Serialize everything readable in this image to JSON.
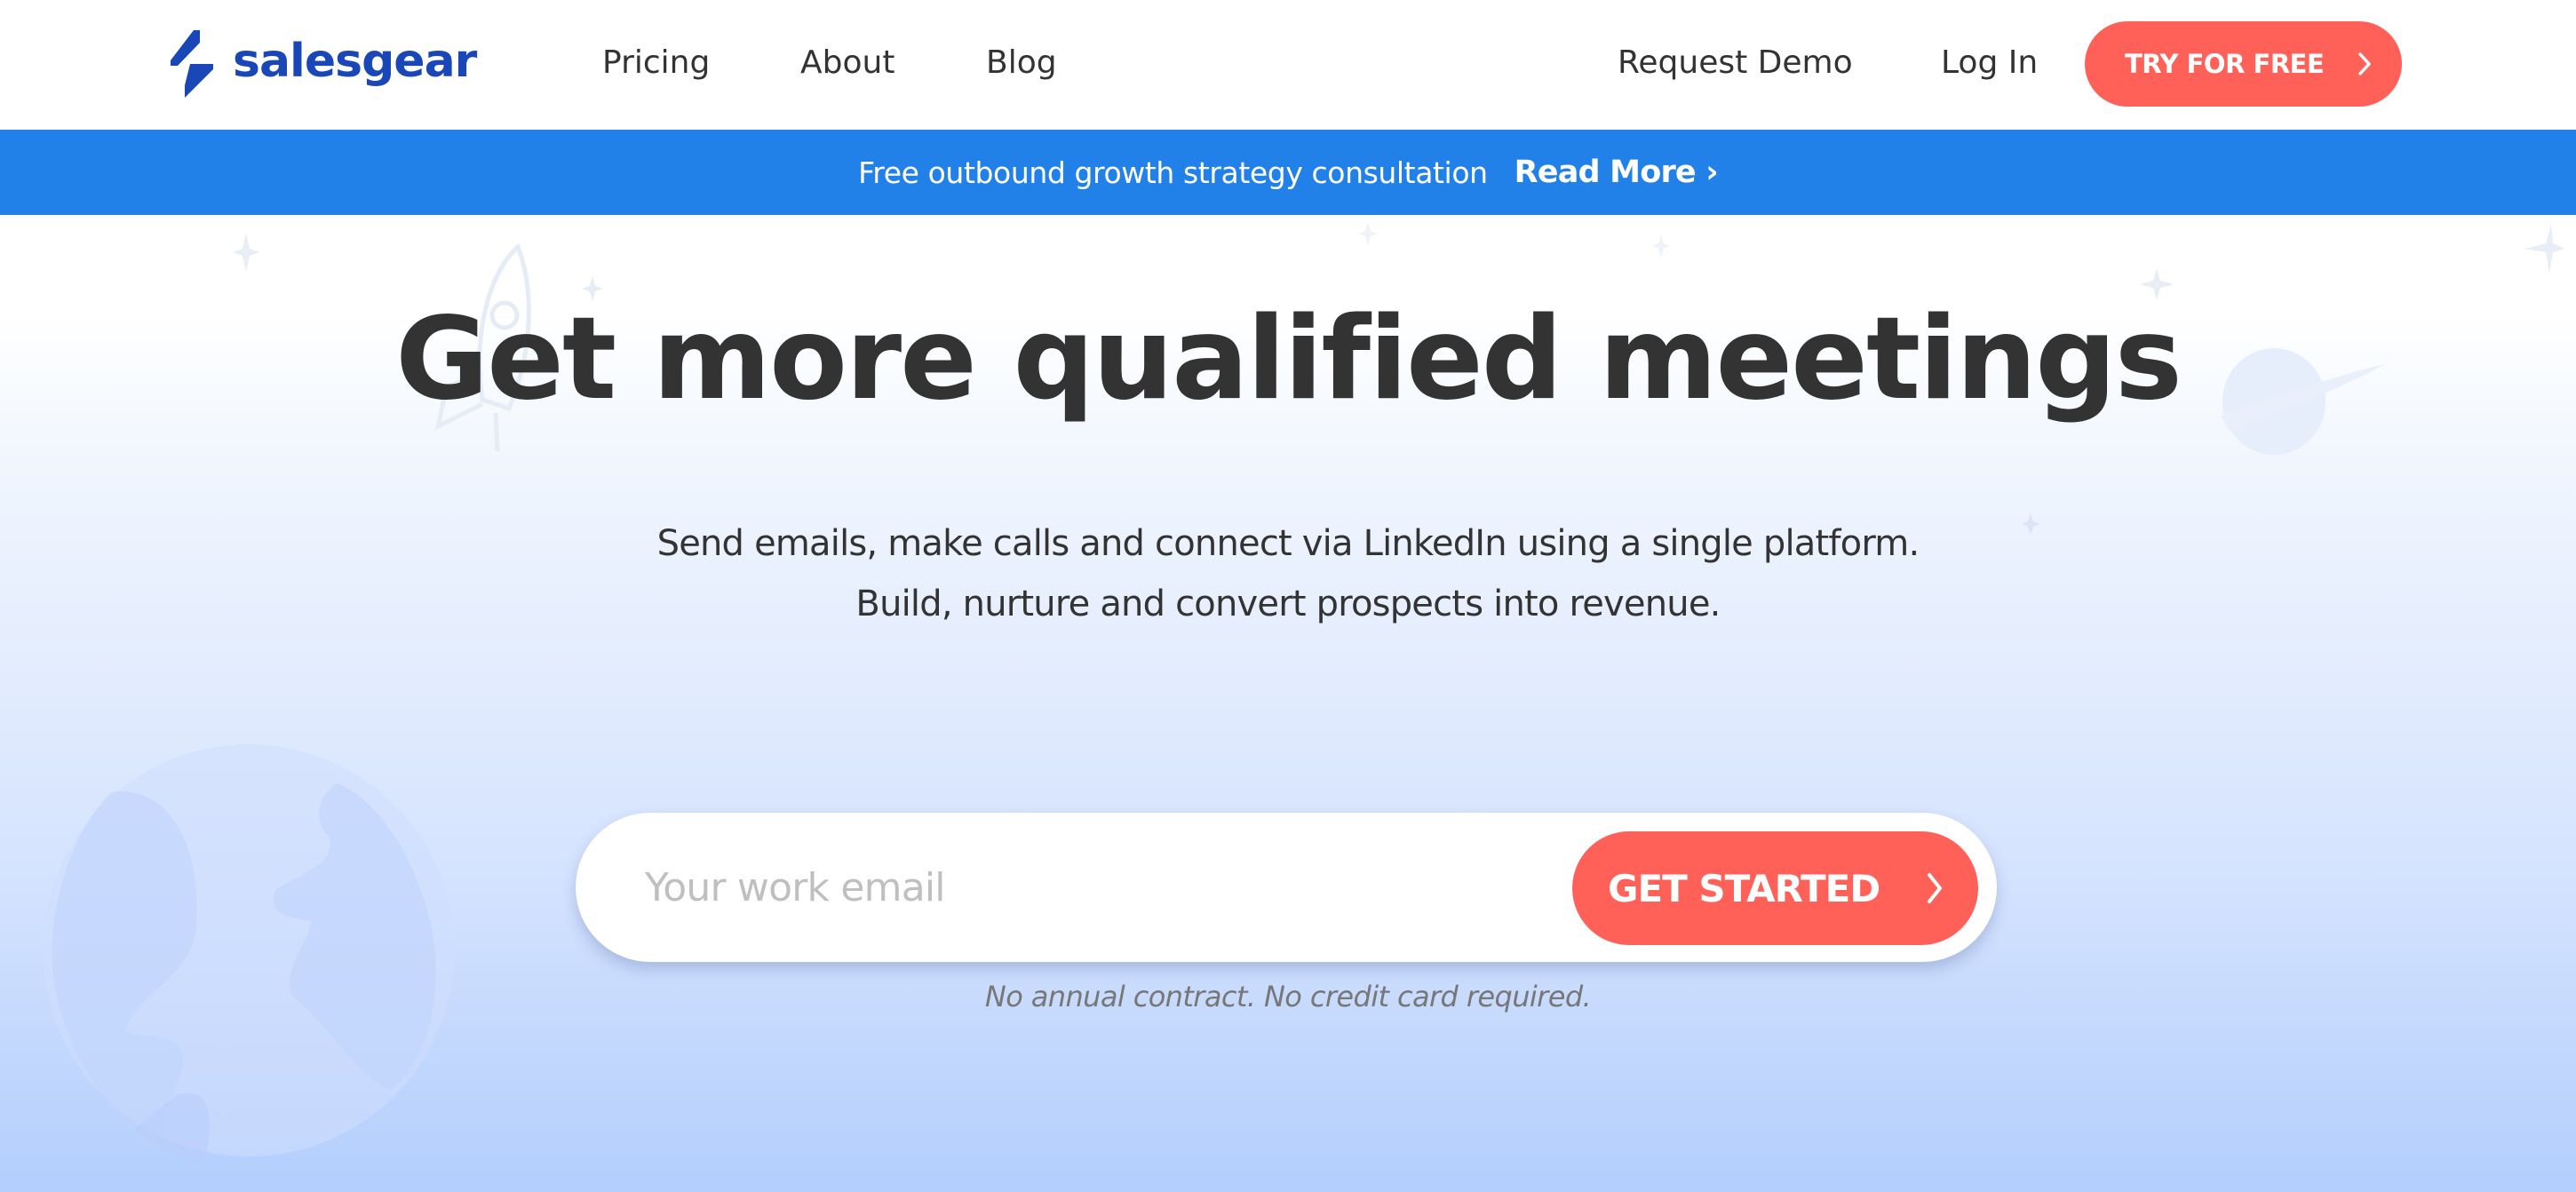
{
  "brand": {
    "name": "salesgear",
    "color": "#1a47b8"
  },
  "nav": {
    "links": [
      {
        "label": "Pricing"
      },
      {
        "label": "About"
      },
      {
        "label": "Blog"
      }
    ],
    "request_demo": "Request Demo",
    "login": "Log In",
    "cta": {
      "label": "TRY FOR FREE",
      "icon": "chevron-right-icon",
      "color": "#ff6159"
    }
  },
  "announcement": {
    "message": "Free outbound growth strategy consultation",
    "link_label": "Read More ›",
    "background": "#2181e9"
  },
  "hero": {
    "headline": "Get more qualified meetings",
    "subline_1": "Send emails, make calls and connect via LinkedIn using a single platform.",
    "subline_2": "Build, nurture and convert prospects into revenue.",
    "email_field": {
      "value": "",
      "placeholder": "Your work email"
    },
    "cta": {
      "label": "GET STARTED",
      "icon": "chevron-right-icon",
      "color": "#ff6159"
    },
    "disclaimer": "No annual contract. No credit card required.",
    "decorations": [
      "rocket-icon",
      "sparkle-star-icon",
      "planet-icon",
      "globe-icon"
    ]
  }
}
